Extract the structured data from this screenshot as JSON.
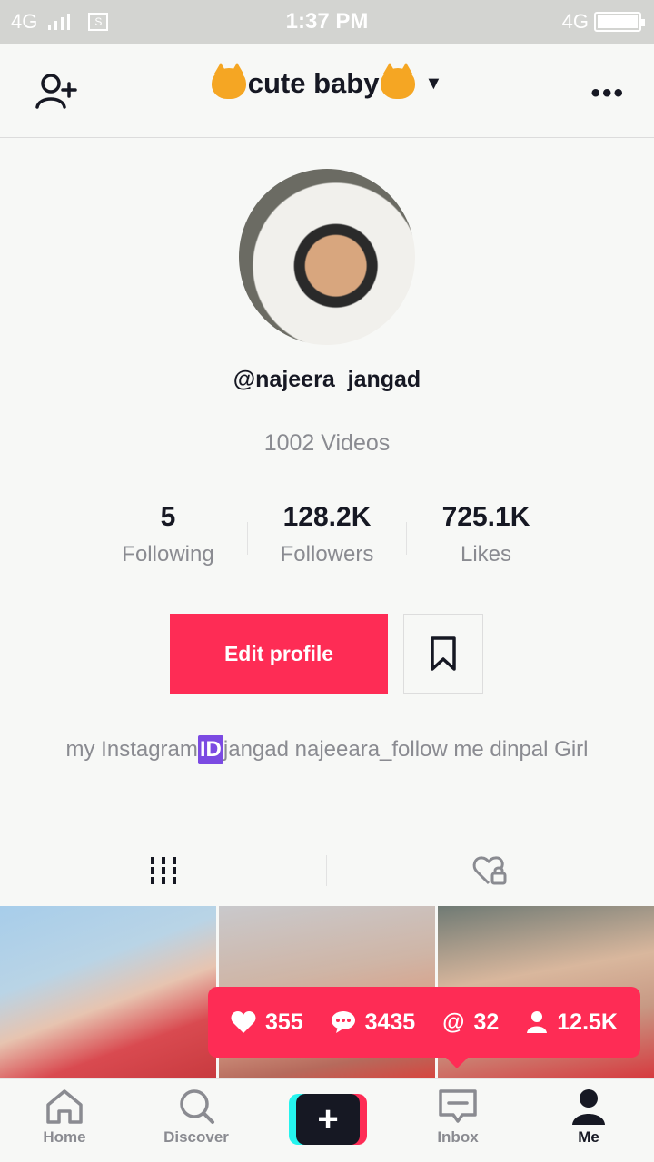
{
  "status_bar": {
    "network_left": "4G",
    "sim_label": "S",
    "time": "1:37 PM",
    "network_right": "4G"
  },
  "header": {
    "title": "cute baby",
    "left_icon": "add-user-icon",
    "right_icon": "more-icon"
  },
  "profile": {
    "username": "@najeera_jangad",
    "videos_count": "1002 Videos",
    "stats": [
      {
        "value": "5",
        "label": "Following"
      },
      {
        "value": "128.2K",
        "label": "Followers"
      },
      {
        "value": "725.1K",
        "label": "Likes"
      }
    ],
    "edit_button": "Edit profile",
    "bio_prefix": "my Instagram",
    "bio_badge": "ID",
    "bio_suffix": "jangad najeeara_follow me dinpal Girl"
  },
  "tabs": [
    {
      "icon": "videos-grid-icon"
    },
    {
      "icon": "liked-locked-icon"
    }
  ],
  "notification": {
    "likes": "355",
    "comments": "3435",
    "mentions_symbol": "@",
    "mentions": "32",
    "followers": "12.5K"
  },
  "bottom_nav": [
    {
      "label": "Home",
      "icon": "home-icon"
    },
    {
      "label": "Discover",
      "icon": "search-icon"
    },
    {
      "label": "+",
      "icon": "plus-icon"
    },
    {
      "label": "Inbox",
      "icon": "inbox-icon"
    },
    {
      "label": "Me",
      "icon": "profile-icon"
    }
  ],
  "colors": {
    "accent": "#fe2c55",
    "cyan": "#25f4ee",
    "badge": "#7b4ae2"
  }
}
